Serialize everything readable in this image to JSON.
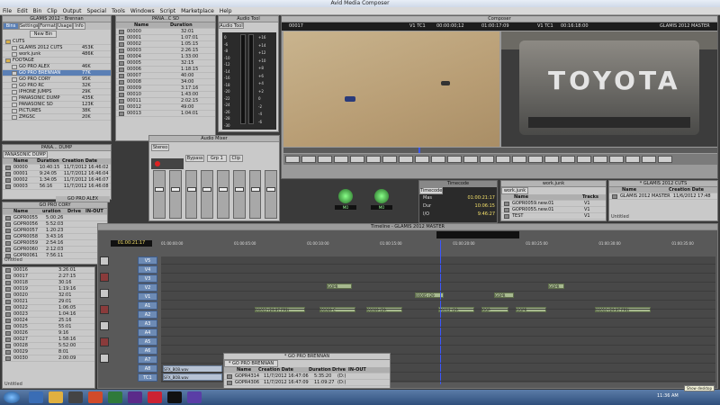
{
  "app": {
    "title": "Avid Media Composer"
  },
  "menu": [
    "File",
    "Edit",
    "Bin",
    "Clip",
    "Output",
    "Special",
    "Tools",
    "Windows",
    "Script",
    "Marketplace",
    "Help"
  ],
  "project": {
    "title": "GLAMIS 2012 - Brennan",
    "tabs": [
      "Bins",
      "Settings",
      "Format",
      "Usage",
      "Info"
    ],
    "new_bin": "New Bin",
    "items": [
      {
        "name": "CUTS",
        "size": ""
      },
      {
        "name": "GLAMIS 2012 CUTS",
        "size": "453K"
      },
      {
        "name": "work.junk",
        "size": "486K"
      },
      {
        "name": "FOOTAGE",
        "size": ""
      },
      {
        "name": "GO PRO ALEX",
        "size": "46K"
      },
      {
        "name": "GO PRO BRENNAN",
        "size": "77K"
      },
      {
        "name": "GO PRO CORY",
        "size": "95K"
      },
      {
        "name": "GO PRO RC",
        "size": "32K"
      },
      {
        "name": "IPHONE JUMPS",
        "size": "29K"
      },
      {
        "name": "PANASONIC DUMP",
        "size": "435K"
      },
      {
        "name": "PANASONIC SD",
        "size": "123K"
      },
      {
        "name": "PICTURES",
        "size": "38K"
      },
      {
        "name": "ZMGSC",
        "size": "20K"
      }
    ]
  },
  "panasonic_sd": {
    "title": "PANA...C SD",
    "headers": [
      "Name",
      "Duration"
    ],
    "rows": [
      [
        "00000",
        "32:01"
      ],
      [
        "00001",
        "1:07:01"
      ],
      [
        "00002",
        "1:05:15"
      ],
      [
        "00003",
        "2:26:15"
      ],
      [
        "00004",
        "1:33:00"
      ],
      [
        "00005",
        "32:15"
      ],
      [
        "00006",
        "1:18:15"
      ],
      [
        "00007",
        "40:00"
      ],
      [
        "00008",
        "34:00"
      ],
      [
        "00009",
        "3:17:16"
      ],
      [
        "00010",
        "1:43:00"
      ],
      [
        "00011",
        "2:02:15"
      ],
      [
        "00012",
        "49:00"
      ],
      [
        "00013",
        "1:04:01"
      ]
    ]
  },
  "audio_tool": {
    "title": "Audio Tool",
    "tab": "Audio Tool",
    "scale": [
      "0",
      "-6",
      "-8",
      "-10",
      "-12",
      "-14",
      "-16",
      "-18",
      "-20",
      "-22",
      "-24",
      "-26",
      "-28",
      "-30"
    ],
    "right_scale": [
      "+16",
      "+14",
      "+12",
      "+10",
      "+8",
      "+6",
      "+4",
      "+2",
      "0",
      "-2",
      "-4",
      "-6"
    ]
  },
  "composer": {
    "title": "Composer",
    "left_clip": "00017",
    "left_track": "V1 TC1",
    "left_tc": "00:00:00;12",
    "mid_tc": "01:00:17:09",
    "right_track": "V1 TC1",
    "right_tc": "00:16:18:00",
    "sequence": "GLAMIS 2012 MASTER",
    "truck_text": "TOYOTA"
  },
  "pana_dump": {
    "title": "PANA... DUMP",
    "tab": "PANASONIC DUMP",
    "headers": [
      "Name",
      "Duration",
      "Creation Date"
    ],
    "rows": [
      [
        "00000",
        "10:40:15",
        "11/7/2012 16:46:02"
      ],
      [
        "00001",
        "9:24:05",
        "11/7/2012 16:46:04"
      ],
      [
        "00002",
        "1:34:05",
        "11/7/2012 16:46:07"
      ],
      [
        "00003",
        "56:16",
        "11/7/2012 16:46:08"
      ]
    ]
  },
  "go_pro_cory": {
    "title": "GO PRO CORY",
    "alex_title": "GO PRO ALEX",
    "headers": [
      "Name",
      "uration",
      "Drive",
      "IN-OUT"
    ],
    "rows": [
      [
        "GOPR0055",
        "5:00:26"
      ],
      [
        "GOPR0056",
        "5:52:03"
      ],
      [
        "GOPR0057",
        "1:20:23"
      ],
      [
        "GOPR0058",
        "3:43:16"
      ],
      [
        "GOPR0059",
        "2:54:16"
      ],
      [
        "GOPR0060",
        "2:12:03"
      ],
      [
        "GOPR0061",
        "7:56:11"
      ]
    ],
    "untitled": "Untitled"
  },
  "source_list": {
    "rows": [
      [
        "00016",
        "3:26:01"
      ],
      [
        "00017",
        "2:27:15"
      ],
      [
        "00018",
        "30:16"
      ],
      [
        "00019",
        "1:19:16"
      ],
      [
        "00020",
        "32:01"
      ],
      [
        "00021",
        "29:01"
      ],
      [
        "00022",
        "1:06:05"
      ],
      [
        "00023",
        "1:04:16"
      ],
      [
        "00024",
        "25:16"
      ],
      [
        "00025",
        "55:01"
      ],
      [
        "00026",
        "9:16"
      ],
      [
        "00027",
        "1:58:16"
      ],
      [
        "00028",
        "5:52:00"
      ],
      [
        "00029",
        "8:01"
      ],
      [
        "00030",
        "2:00:09"
      ]
    ],
    "untitled": "Untitled"
  },
  "audio_mixer": {
    "title": "Audio Mixer",
    "stereo": "Stereo",
    "bypass": "Bypass",
    "grp": "Grp 1",
    "clip": "Clip",
    "knob_values": [
      "MO",
      "MO"
    ]
  },
  "timecode": {
    "title": "Timecode",
    "tab": "Timecode",
    "rows": [
      [
        "Mas",
        "01:00:21:17"
      ],
      [
        "Dur",
        "10:06:15"
      ],
      [
        "I/O",
        "9:46:27"
      ]
    ]
  },
  "work_junk": {
    "title": "work.junk",
    "tab": "work.junk",
    "headers": [
      "Name",
      "Tracks"
    ],
    "rows": [
      [
        "GOPR0059.new.01",
        "V1"
      ],
      [
        "GOPR0055.new.01",
        "V1"
      ],
      [
        "TEST",
        "V1"
      ]
    ]
  },
  "glamis_cuts": {
    "title": "* GLAMIS 2012 CUTS",
    "tab": "* GLAMIS 2012 CUTS",
    "headers": [
      "Name",
      "Creation Date"
    ],
    "rows": [
      [
        "GLAMIS 2012 MASTER",
        "11/6/2012 17:48"
      ]
    ],
    "untitled": "Untitled"
  },
  "timeline": {
    "title": "Timeline - GLAMIS 2012 MASTER",
    "position_tc": "01:00:21:17",
    "ruler": [
      "01:00:00:00",
      "01:00:05:00",
      "01:00:10:00",
      "01:00:15:00",
      "01:00:20:00",
      "01:00:25:00",
      "01:00:30:00",
      "01:00:35:00"
    ],
    "tracks": [
      "V5",
      "V4",
      "V3",
      "V2",
      "V1",
      "A1",
      "A2",
      "A3",
      "A4",
      "A5",
      "A6",
      "A7",
      "A8",
      "TC1"
    ],
    "clip_labels": {
      "v1_a": "00015 (29.97 FPS)",
      "v1_b": "00009 C",
      "v1_c": "00009 (29.",
      "v1_d": "00012 (29.",
      "v1_e": "GOP",
      "v1_f": "GOPR",
      "v1_g": "00010 (29.97 FPS)",
      "v2_a": "00005 (29",
      "v2_b": "GOPR",
      "v3_a": "GOPR",
      "v3_b": "GOPR",
      "a5": "SFX_BOB.wav",
      "a6": "SFX_BOB.wav"
    }
  },
  "go_pro_brennan": {
    "title": "* GO PRO BRENNAN",
    "tab": "* GO PRO BRENNAN",
    "headers": [
      "Name",
      "Creation Date",
      "Duration",
      "Drive",
      "IN-OUT"
    ],
    "rows": [
      [
        "GOPR4314",
        "11/7/2012 16:47:06",
        "5:35:20",
        "(D:)"
      ],
      [
        "GOPR4306",
        "11/7/2012 16:47:09",
        "11:09:27",
        "(D:)"
      ]
    ],
    "untitled": "Untitled"
  },
  "taskbar": {
    "time": "11:36 AM",
    "show_desktop": "Show desktop"
  },
  "colors": {
    "track_blue": "#6d8bb5",
    "clip_green": "#a7b98f",
    "playhead": "#3b57ff",
    "panel": "#c9c9c9"
  }
}
